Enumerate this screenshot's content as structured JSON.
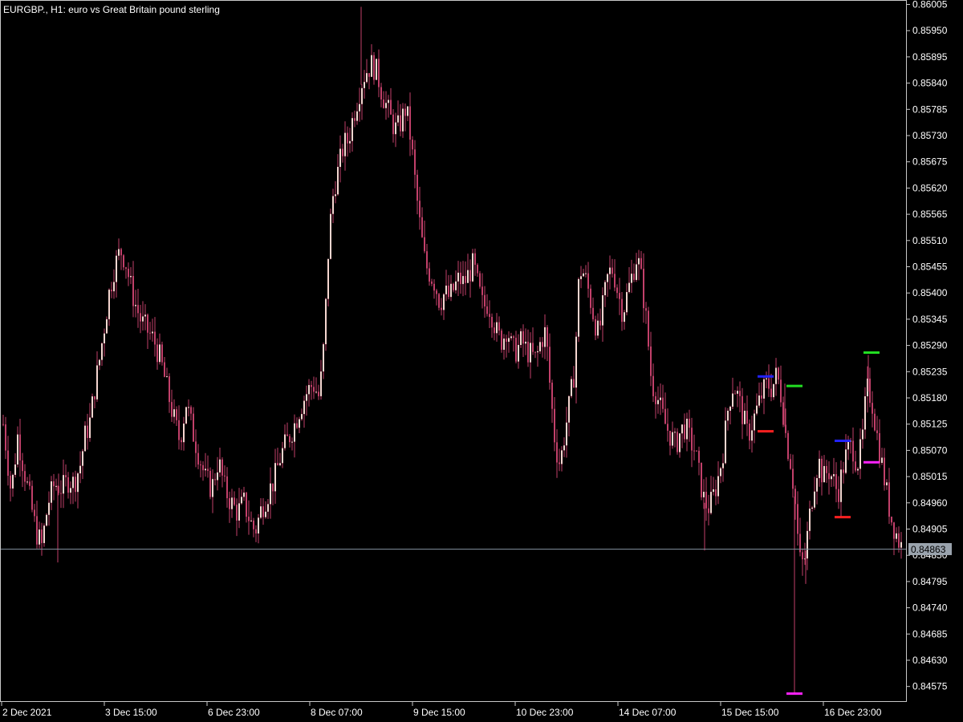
{
  "window": {
    "title": "EURGBP., H1:  euro vs Great Britain pound sterling"
  },
  "colors": {
    "background": "#000000",
    "frame": "#c8c8c8",
    "bull_body": "#f5d6d0",
    "bear_body": "#c2406a",
    "wick": "#c2406a",
    "bid_line": "#7f8c9a",
    "price_tag_bg": "#9aa3ad"
  },
  "chart_data": {
    "type": "candlestick",
    "title": "EURGBP., H1:  euro vs Great Britain pound sterling",
    "symbol": "EURGBP.",
    "timeframe": "H1",
    "ylim": [
      0.8452,
      0.86025
    ],
    "y_ticks": [
      "0.86005",
      "0.85950",
      "0.85895",
      "0.85840",
      "0.85785",
      "0.85730",
      "0.85675",
      "0.85620",
      "0.85565",
      "0.85510",
      "0.85455",
      "0.85400",
      "0.85345",
      "0.85290",
      "0.85235",
      "0.85180",
      "0.85125",
      "0.85070",
      "0.85015",
      "0.84960",
      "0.84905",
      "0.84850",
      "0.84795",
      "0.84740",
      "0.84685",
      "0.84630",
      "0.84575"
    ],
    "x_ticks": [
      "2 Dec 2021",
      "3 Dec 15:00",
      "6 Dec 23:00",
      "8 Dec 07:00",
      "9 Dec 15:00",
      "10 Dec 23:00",
      "14 Dec 07:00",
      "15 Dec 15:00",
      "16 Dec 23:00"
    ],
    "current_price": "0.84863",
    "grid": false,
    "price_path": [
      [
        0,
        0.8518
      ],
      [
        8,
        0.8507
      ],
      [
        14,
        0.8498
      ],
      [
        22,
        0.851
      ],
      [
        30,
        0.8503
      ],
      [
        38,
        0.8496
      ],
      [
        45,
        0.849
      ],
      [
        52,
        0.8487
      ],
      [
        60,
        0.8496
      ],
      [
        68,
        0.85
      ],
      [
        78,
        0.8499
      ],
      [
        86,
        0.8501
      ],
      [
        92,
        0.85
      ],
      [
        100,
        0.8504
      ],
      [
        106,
        0.851
      ],
      [
        112,
        0.8513
      ],
      [
        118,
        0.852
      ],
      [
        124,
        0.8526
      ],
      [
        130,
        0.8533
      ],
      [
        136,
        0.854
      ],
      [
        142,
        0.8545
      ],
      [
        150,
        0.8549
      ],
      [
        156,
        0.8547
      ],
      [
        162,
        0.8542
      ],
      [
        168,
        0.8538
      ],
      [
        176,
        0.8534
      ],
      [
        184,
        0.8532
      ],
      [
        192,
        0.853
      ],
      [
        200,
        0.8526
      ],
      [
        208,
        0.852
      ],
      [
        216,
        0.8514
      ],
      [
        224,
        0.8509
      ],
      [
        232,
        0.8517
      ],
      [
        240,
        0.8511
      ],
      [
        248,
        0.8506
      ],
      [
        256,
        0.8501
      ],
      [
        264,
        0.8499
      ],
      [
        272,
        0.8505
      ],
      [
        280,
        0.8499
      ],
      [
        288,
        0.8496
      ],
      [
        296,
        0.8494
      ],
      [
        304,
        0.8496
      ],
      [
        312,
        0.8492
      ],
      [
        318,
        0.849
      ],
      [
        326,
        0.8495
      ],
      [
        334,
        0.8498
      ],
      [
        342,
        0.8501
      ],
      [
        350,
        0.8506
      ],
      [
        358,
        0.8509
      ],
      [
        366,
        0.8512
      ],
      [
        374,
        0.8516
      ],
      [
        382,
        0.8519
      ],
      [
        390,
        0.8521
      ],
      [
        398,
        0.8518
      ],
      [
        404,
        0.853
      ],
      [
        410,
        0.8552
      ],
      [
        416,
        0.8562
      ],
      [
        422,
        0.8566
      ],
      [
        428,
        0.8571
      ],
      [
        434,
        0.8572
      ],
      [
        440,
        0.8577
      ],
      [
        446,
        0.8581
      ],
      [
        452,
        0.8585
      ],
      [
        458,
        0.8587
      ],
      [
        464,
        0.8588
      ],
      [
        470,
        0.8586
      ],
      [
        476,
        0.8582
      ],
      [
        482,
        0.8579
      ],
      [
        488,
        0.8576
      ],
      [
        494,
        0.8574
      ],
      [
        500,
        0.8576
      ],
      [
        506,
        0.8579
      ],
      [
        512,
        0.8572
      ],
      [
        518,
        0.8562
      ],
      [
        524,
        0.8553
      ],
      [
        530,
        0.8546
      ],
      [
        536,
        0.8544
      ],
      [
        542,
        0.8542
      ],
      [
        548,
        0.8538
      ],
      [
        554,
        0.854
      ],
      [
        560,
        0.8539
      ],
      [
        566,
        0.8541
      ],
      [
        572,
        0.8543
      ],
      [
        578,
        0.8542
      ],
      [
        584,
        0.8544
      ],
      [
        590,
        0.8546
      ],
      [
        596,
        0.8541
      ],
      [
        602,
        0.8537
      ],
      [
        608,
        0.8538
      ],
      [
        614,
        0.8535
      ],
      [
        620,
        0.8531
      ],
      [
        626,
        0.853
      ],
      [
        632,
        0.8533
      ],
      [
        638,
        0.8528
      ],
      [
        644,
        0.8528
      ],
      [
        650,
        0.853
      ],
      [
        656,
        0.8528
      ],
      [
        662,
        0.8527
      ],
      [
        668,
        0.8526
      ],
      [
        674,
        0.853
      ],
      [
        680,
        0.8532
      ],
      [
        686,
        0.8519
      ],
      [
        692,
        0.8508
      ],
      [
        698,
        0.8504
      ],
      [
        704,
        0.8511
      ],
      [
        710,
        0.8517
      ],
      [
        716,
        0.8524
      ],
      [
        722,
        0.8545
      ],
      [
        728,
        0.8544
      ],
      [
        734,
        0.854
      ],
      [
        740,
        0.8535
      ],
      [
        746,
        0.8531
      ],
      [
        752,
        0.8538
      ],
      [
        758,
        0.8544
      ],
      [
        764,
        0.8545
      ],
      [
        770,
        0.854
      ],
      [
        776,
        0.8536
      ],
      [
        782,
        0.854
      ],
      [
        788,
        0.8544
      ],
      [
        794,
        0.8548
      ],
      [
        800,
        0.8542
      ],
      [
        806,
        0.8533
      ],
      [
        812,
        0.8521
      ],
      [
        818,
        0.8519
      ],
      [
        824,
        0.8515
      ],
      [
        830,
        0.8512
      ],
      [
        836,
        0.851
      ],
      [
        842,
        0.8508
      ],
      [
        848,
        0.8511
      ],
      [
        854,
        0.8512
      ],
      [
        860,
        0.8509
      ],
      [
        866,
        0.8507
      ],
      [
        872,
        0.8501
      ],
      [
        878,
        0.8496
      ],
      [
        884,
        0.8495
      ],
      [
        890,
        0.8498
      ],
      [
        896,
        0.8502
      ],
      [
        902,
        0.8508
      ],
      [
        908,
        0.8517
      ],
      [
        914,
        0.8521
      ],
      [
        920,
        0.8518
      ],
      [
        926,
        0.8514
      ],
      [
        932,
        0.851
      ],
      [
        938,
        0.8513
      ],
      [
        944,
        0.8516
      ],
      [
        950,
        0.8519
      ],
      [
        956,
        0.8521
      ],
      [
        962,
        0.852
      ],
      [
        968,
        0.8523
      ],
      [
        974,
        0.8518
      ],
      [
        980,
        0.8509
      ],
      [
        986,
        0.8504
      ],
      [
        992,
        0.8494
      ],
      [
        996,
        0.8484
      ],
      [
        1002,
        0.8483
      ],
      [
        1008,
        0.8492
      ],
      [
        1014,
        0.85
      ],
      [
        1020,
        0.8505
      ],
      [
        1026,
        0.8501
      ],
      [
        1032,
        0.8503
      ],
      [
        1038,
        0.8501
      ],
      [
        1044,
        0.8498
      ],
      [
        1050,
        0.8503
      ],
      [
        1056,
        0.8507
      ],
      [
        1062,
        0.8508
      ],
      [
        1068,
        0.8504
      ],
      [
        1074,
        0.8508
      ],
      [
        1080,
        0.852
      ],
      [
        1086,
        0.8518
      ],
      [
        1092,
        0.8511
      ],
      [
        1098,
        0.8505
      ],
      [
        1104,
        0.8499
      ],
      [
        1110,
        0.8493
      ],
      [
        1116,
        0.849
      ],
      [
        1122,
        0.8487
      ]
    ],
    "extra_wicks": [
      {
        "x": 450,
        "high": 0.86
      },
      {
        "x": 990,
        "low": 0.8456
      },
      {
        "x": 978,
        "high": 0.8521
      },
      {
        "x": 1082,
        "high": 0.8527
      },
      {
        "x": 72,
        "low": 0.84835
      },
      {
        "x": 878,
        "low": 0.8486
      },
      {
        "x": 1004,
        "low": 0.8479
      }
    ],
    "level_marks": [
      {
        "x1": 944,
        "x2": 964,
        "price": 0.85225,
        "color": "#2222ff"
      },
      {
        "x1": 944,
        "x2": 964,
        "price": 0.8511,
        "color": "#ff2020"
      },
      {
        "x1": 980,
        "x2": 1000,
        "price": 0.85205,
        "color": "#22dd22"
      },
      {
        "x1": 980,
        "x2": 1000,
        "price": 0.8456,
        "color": "#ff22ff"
      },
      {
        "x1": 1040,
        "x2": 1060,
        "price": 0.8509,
        "color": "#2222ff"
      },
      {
        "x1": 1040,
        "x2": 1060,
        "price": 0.8493,
        "color": "#ff2020"
      },
      {
        "x1": 1076,
        "x2": 1096,
        "price": 0.85275,
        "color": "#22dd22"
      },
      {
        "x1": 1076,
        "x2": 1096,
        "price": 0.85045,
        "color": "#ff22ff"
      }
    ]
  }
}
